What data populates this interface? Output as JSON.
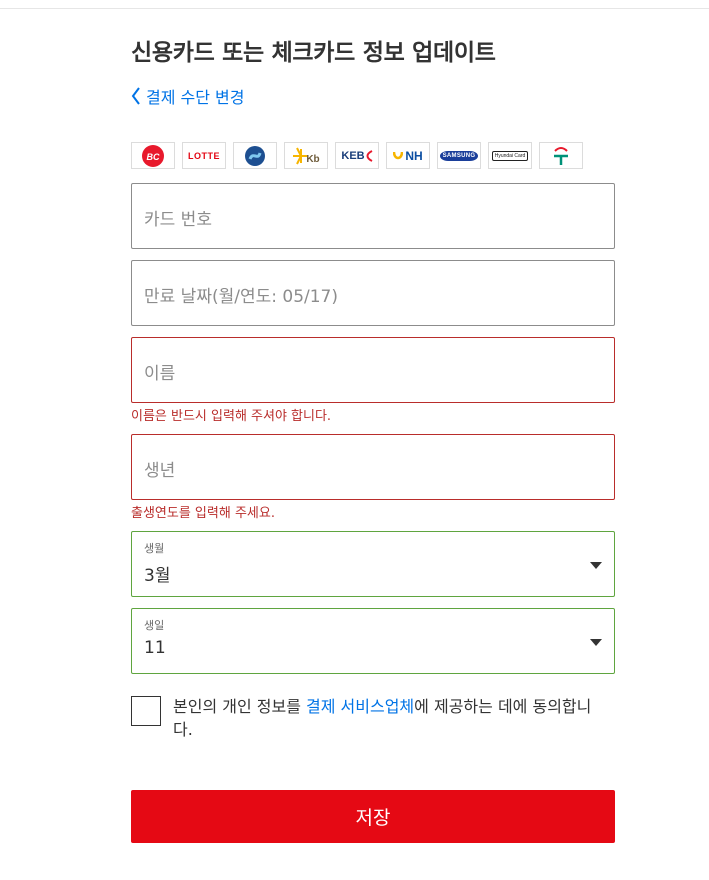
{
  "page": {
    "title": "신용카드 또는 체크카드 정보 업데이트",
    "back_link": "결제 수단 변경"
  },
  "card_logos": [
    {
      "name": "bc-card-logo",
      "text": "BC",
      "color": "#e8192c"
    },
    {
      "name": "lotte-card-logo",
      "text": "LOTTE",
      "color": "#e30613"
    },
    {
      "name": "shinhan-card-logo",
      "text": "",
      "color": "#1d4f91"
    },
    {
      "name": "kb-card-logo",
      "text": "Kb",
      "color": "#f7b500"
    },
    {
      "name": "keb-card-logo",
      "text": "KEB",
      "color": "#1a3e7a"
    },
    {
      "name": "nh-card-logo",
      "text": "NH",
      "color": "#0b4ea2"
    },
    {
      "name": "samsung-card-logo",
      "text": "SAMSUNG",
      "color": "#1a3e9a"
    },
    {
      "name": "hyundai-card-logo",
      "text": "Hyundai Card",
      "color": "#222222"
    },
    {
      "name": "hana-card-logo",
      "text": "",
      "color": "#009178"
    }
  ],
  "form": {
    "card_number_placeholder": "카드 번호",
    "expiry_placeholder": "만료 날짜(월/연도: 05/17)",
    "name_placeholder": "이름",
    "name_error": "이름은 반드시 입력해 주셔야 합니다.",
    "birth_year_placeholder": "생년",
    "birth_year_error": "출생연도를 입력해 주세요.",
    "birth_month_label": "생월",
    "birth_month_value": "3월",
    "birth_day_label": "생일",
    "birth_day_value": "11"
  },
  "consent": {
    "text_before": "본인의 개인 정보를 ",
    "link_text": "결제 서비스업체",
    "text_after": "에 제공하는 데에 동의합니다."
  },
  "save_button": "저장",
  "colors": {
    "accent": "#e50914",
    "link": "#0073e6",
    "error": "#b92d2b",
    "valid": "#5fa53f"
  }
}
